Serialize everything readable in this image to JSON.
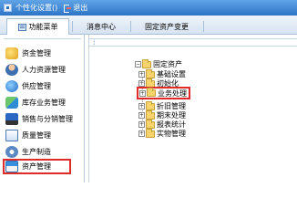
{
  "titlebar": {
    "personalize_label": "个性化设置()",
    "exit_label": "退出"
  },
  "tabs": [
    {
      "label": "功能菜单",
      "active": true
    },
    {
      "label": "消息中心",
      "active": false
    },
    {
      "label": "固定资产变更",
      "active": false
    }
  ],
  "sidebar": {
    "items": [
      {
        "label": "资金管理",
        "icon": "coins-icon"
      },
      {
        "label": "人力资源管理",
        "icon": "person-icon"
      },
      {
        "label": "供应管理",
        "icon": "supply-globe-icon"
      },
      {
        "label": "库存业务管理",
        "icon": "inventory-icon"
      },
      {
        "label": "销售与分销管理",
        "icon": "truck-icon"
      },
      {
        "label": "质量管理",
        "icon": "document-icon"
      },
      {
        "label": "生产制造",
        "icon": "gear-icon"
      },
      {
        "label": "资产管理",
        "icon": "home-icon",
        "selected": true
      }
    ]
  },
  "tree": {
    "root": "固定资产",
    "children": [
      "基础设置",
      "初始化",
      "业务处理",
      "折旧管理",
      "期末处理",
      "报表统计",
      "实物管理"
    ],
    "highlighted": "业务处理"
  },
  "colors": {
    "titlebar": "#2c74c7",
    "highlight_border": "#e02b2b"
  }
}
